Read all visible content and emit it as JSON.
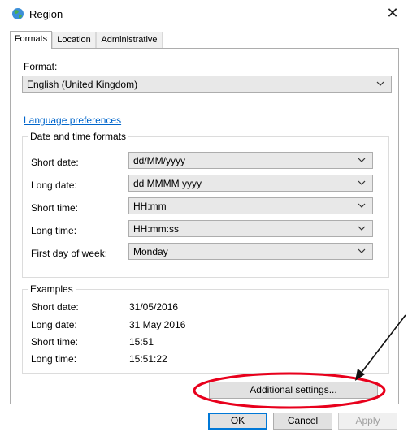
{
  "window": {
    "title": "Region"
  },
  "tabs": [
    {
      "label": "Formats"
    },
    {
      "label": "Location"
    },
    {
      "label": "Administrative"
    }
  ],
  "format": {
    "label": "Format:",
    "value": "English (United Kingdom)"
  },
  "language_link": "Language preferences",
  "date_time": {
    "group_title": "Date and time formats",
    "rows": [
      {
        "label": "Short date:",
        "value": "dd/MM/yyyy"
      },
      {
        "label": "Long date:",
        "value": "dd MMMM yyyy"
      },
      {
        "label": "Short time:",
        "value": "HH:mm"
      },
      {
        "label": "Long time:",
        "value": "HH:mm:ss"
      },
      {
        "label": "First day of week:",
        "value": "Monday"
      }
    ]
  },
  "examples": {
    "group_title": "Examples",
    "rows": [
      {
        "label": "Short date:",
        "value": "31/05/2016"
      },
      {
        "label": "Long date:",
        "value": "31 May 2016"
      },
      {
        "label": "Short time:",
        "value": "15:51"
      },
      {
        "label": "Long time:",
        "value": "15:51:22"
      }
    ]
  },
  "buttons": {
    "additional_settings": "Additional settings...",
    "ok": "OK",
    "cancel": "Cancel",
    "apply": "Apply"
  },
  "colors": {
    "annotation": "#e8001c",
    "link": "#0066cc",
    "default_button_border": "#0078d7"
  },
  "icons": {
    "app": "globe-icon",
    "close": "close-icon",
    "dropdown": "chevron-down-icon"
  }
}
